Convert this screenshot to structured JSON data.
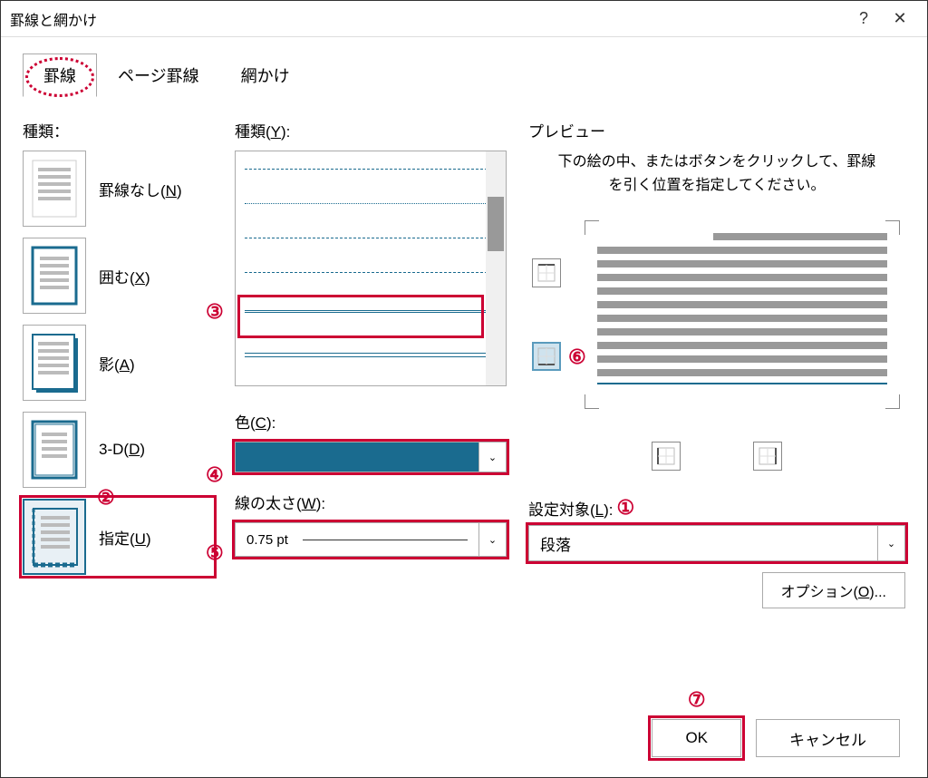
{
  "window": {
    "title": "罫線と網かけ"
  },
  "tabs": {
    "t1": "罫線",
    "t2": "ページ罫線",
    "t3": "網かけ",
    "active": "t1"
  },
  "left": {
    "heading": "種類：",
    "items": [
      {
        "label": "罫線なし(N)"
      },
      {
        "label": "囲む(X)"
      },
      {
        "label": "影(A)"
      },
      {
        "label": "3-D(D)"
      },
      {
        "label": "指定(U)"
      }
    ]
  },
  "style": {
    "heading_pre": "種類(",
    "heading_u": "Y",
    "heading_post": "):",
    "color_pre": "色(",
    "color_u": "C",
    "color_post": "):",
    "width_pre": "線の太さ(",
    "width_u": "W",
    "width_post": "):",
    "width_value": "0.75 pt",
    "color_value": "#1a6b8f"
  },
  "preview": {
    "heading": "プレビュー",
    "hint": "下の絵の中、またはボタンをクリックして、罫線を引く位置を指定してください。",
    "apply_pre": "設定対象(",
    "apply_u": "L",
    "apply_post": "):",
    "apply_value": "段落",
    "options_pre": "オプション(",
    "options_u": "O",
    "options_post": ")..."
  },
  "footer": {
    "ok": "OK",
    "cancel": "キャンセル"
  },
  "callouts": {
    "c1": "①",
    "c2": "②",
    "c3": "③",
    "c4": "④",
    "c5": "⑤",
    "c6": "⑥",
    "c7": "⑦"
  }
}
